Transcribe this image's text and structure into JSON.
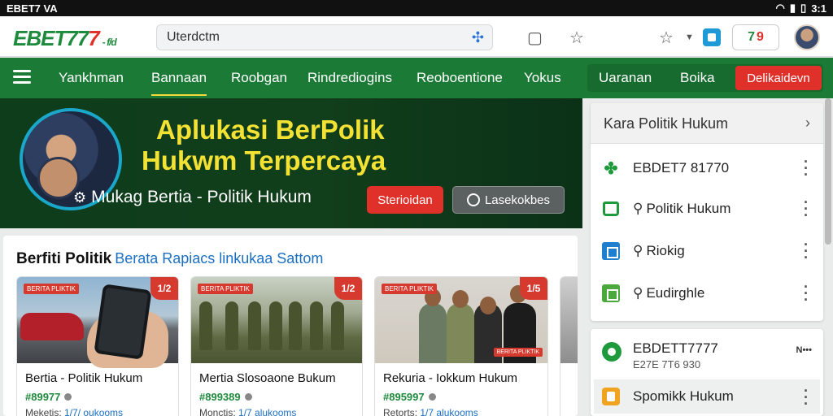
{
  "statusbar": {
    "left": "EBET7 VA",
    "right": "3:1"
  },
  "browser": {
    "logo_main": "EBET77",
    "logo_red": "7",
    "logo_tag": "- f/d",
    "url": "Uterdctm",
    "score_green": "7",
    "score_red": "9"
  },
  "nav": {
    "items": [
      "Yankhman",
      "Bannaan",
      "Roobgan",
      "Rindrediogins",
      "Reoboentione",
      "Yokus",
      "Uaranan",
      "Boika"
    ],
    "cta": "Delikaidevn"
  },
  "hero": {
    "title_line1": "Aplukasi BerPolik",
    "title_line2": "Hukwm Terpercaya",
    "subtitle": "Mukag Bertia - Politik Hukum",
    "btn_primary": "Sterioidan",
    "btn_secondary": "Lasekokbes"
  },
  "section": {
    "title": "Berfiti Politik",
    "title_blue": "Berata Rapiacs linkukaa Sattom"
  },
  "cards": [
    {
      "badge": "BERITA PLIKTIK",
      "corner": "1/2",
      "title": "Bertia - Politik Hukum",
      "score": "#89977",
      "meta_label": "Meketis",
      "meta_value": "1/7/ oukooms"
    },
    {
      "badge": "BERITA PLIKTIK",
      "corner": "1/2",
      "title": "Mertia Slosoaone Bukum",
      "score": "#899389",
      "meta_label": "Monctis",
      "meta_value": "1/7 alukooms"
    },
    {
      "badge": "BERITA PLIKTIK",
      "corner": "1/5",
      "title": "Rekuria - Iokkum Hukum",
      "score": "#895997",
      "meta_label": "Retorts",
      "meta_value": "1/7 alukooms",
      "caption": "BERITA PLIKTIK"
    }
  ],
  "panel1": {
    "header": "Kara Politik Hukum",
    "rows": [
      {
        "label": "EBDET7 81770",
        "icon": "clover-icon"
      },
      {
        "label": "Politik Hukum",
        "icon": "home-icon"
      },
      {
        "label": "Riokig",
        "icon": "square-icon"
      },
      {
        "label": "Eudirghle",
        "icon": "square-icon"
      }
    ]
  },
  "panel2": {
    "title": "EBDETT7777",
    "subtitle": "E27E 7T6 930",
    "more": "N•••",
    "row": "Spomikk Hukum"
  }
}
